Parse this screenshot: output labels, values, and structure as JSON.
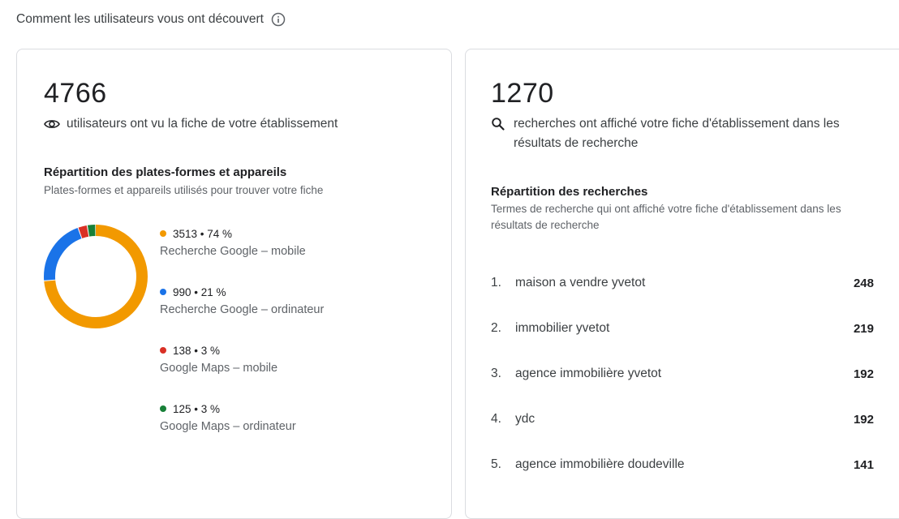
{
  "header": {
    "title": "Comment les utilisateurs vous ont découvert",
    "info_icon": "info-icon"
  },
  "left_card": {
    "total": "4766",
    "total_label": "utilisateurs ont vu la fiche de votre établissement",
    "total_icon": "eye-icon",
    "breakdown_title": "Répartition des plates-formes et appareils",
    "breakdown_subtitle": "Plates-formes et appareils utilisés pour trouver votre fiche",
    "legend": [
      {
        "value": "3513 • 74 %",
        "label": "Recherche Google – mobile",
        "color": "#f29900"
      },
      {
        "value": "990 • 21 %",
        "label": "Recherche Google – ordinateur",
        "color": "#1a73e8"
      },
      {
        "value": "138 • 3 %",
        "label": "Google Maps – mobile",
        "color": "#d93025"
      },
      {
        "value": "125 • 3 %",
        "label": "Google Maps – ordinateur",
        "color": "#188038"
      }
    ]
  },
  "chart_data": {
    "type": "pie",
    "categories": [
      "Recherche Google – mobile",
      "Recherche Google – ordinateur",
      "Google Maps – mobile",
      "Google Maps – ordinateur"
    ],
    "values": [
      3513,
      990,
      138,
      125
    ],
    "colors": [
      "#f29900",
      "#1a73e8",
      "#d93025",
      "#188038"
    ],
    "donut": true,
    "title": "",
    "xlabel": "",
    "ylabel": ""
  },
  "right_card": {
    "total": "1270",
    "total_label": "recherches ont affiché votre fiche d'établissement dans les résultats de recherche",
    "total_icon": "search-icon",
    "breakdown_title": "Répartition des recherches",
    "breakdown_subtitle": "Termes de recherche qui ont affiché votre fiche d'établissement dans les résultats de recherche",
    "terms": [
      {
        "rank": "1.",
        "term": "maison a vendre yvetot",
        "count": "248"
      },
      {
        "rank": "2.",
        "term": "immobilier yvetot",
        "count": "219"
      },
      {
        "rank": "3.",
        "term": "agence immobilière yvetot",
        "count": "192"
      },
      {
        "rank": "4.",
        "term": "ydc",
        "count": "192"
      },
      {
        "rank": "5.",
        "term": "agence immobilière doudeville",
        "count": "141"
      }
    ]
  }
}
